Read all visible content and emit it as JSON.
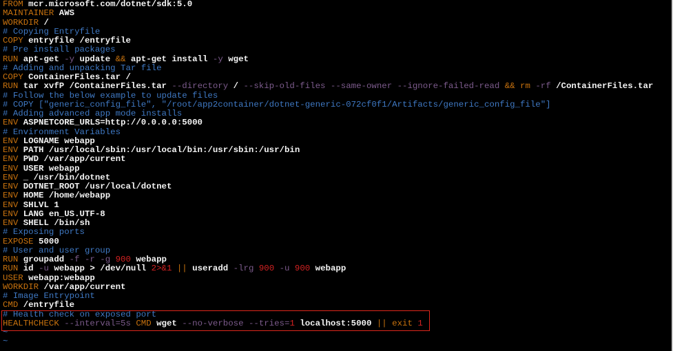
{
  "editor": {
    "lines": [
      [
        [
          "k",
          "FROM"
        ],
        [
          "t",
          " mcr.microsoft.com/dotnet/sdk:5.0"
        ]
      ],
      [
        [
          "k",
          "MAINTAINER"
        ],
        [
          "t",
          " AWS"
        ]
      ],
      [
        [
          "k",
          "WORKDIR"
        ],
        [
          "t",
          " /"
        ]
      ],
      [
        [
          "c",
          "# Copying Entryfile"
        ]
      ],
      [
        [
          "k",
          "COPY"
        ],
        [
          "t",
          " entryfile /entryfile"
        ]
      ],
      [
        [
          "c",
          "# Pre install packages"
        ]
      ],
      [
        [
          "k",
          "RUN"
        ],
        [
          "t",
          " apt-get "
        ],
        [
          "f",
          "-y"
        ],
        [
          "t",
          " update "
        ],
        [
          "o",
          "&&"
        ],
        [
          "t",
          " apt-get install "
        ],
        [
          "f",
          "-y"
        ],
        [
          "t",
          " wget"
        ]
      ],
      [
        [
          "c",
          "# Adding and unpacking Tar file"
        ]
      ],
      [
        [
          "k",
          "COPY"
        ],
        [
          "t",
          " ContainerFiles.tar /"
        ]
      ],
      [
        [
          "k",
          "RUN"
        ],
        [
          "t",
          " tar xvfP /ContainerFiles.tar "
        ],
        [
          "f",
          "--directory"
        ],
        [
          "t",
          " / "
        ],
        [
          "f",
          "--skip-old-files --same-owner --ignore-failed-read"
        ],
        [
          "t",
          " "
        ],
        [
          "o",
          "&&"
        ],
        [
          "t",
          " "
        ],
        [
          "o",
          "rm"
        ],
        [
          "t",
          " "
        ],
        [
          "f",
          "-rf"
        ],
        [
          "t",
          " /ContainerFiles.tar"
        ]
      ],
      [
        [
          "c",
          "# Follow the below example to update files"
        ]
      ],
      [
        [
          "c",
          "# COPY [\"generic_config_file\", \"/root/app2container/dotnet-generic-072cf0f1/Artifacts/generic_config_file\"]"
        ]
      ],
      [
        [
          "c",
          "# Adding advanced app mode installs"
        ]
      ],
      [
        [
          "k",
          "ENV"
        ],
        [
          "t",
          " ASPNETCORE_URLS=http://0.0.0.0:5000"
        ]
      ],
      [
        [
          "c",
          "# Environment Variables"
        ]
      ],
      [
        [
          "k",
          "ENV"
        ],
        [
          "t",
          " LOGNAME webapp"
        ]
      ],
      [
        [
          "k",
          "ENV"
        ],
        [
          "t",
          " PATH /usr/local/sbin:/usr/local/bin:/usr/sbin:/usr/bin"
        ]
      ],
      [
        [
          "k",
          "ENV"
        ],
        [
          "t",
          " PWD /var/app/current"
        ]
      ],
      [
        [
          "k",
          "ENV"
        ],
        [
          "t",
          " USER webapp"
        ]
      ],
      [
        [
          "k",
          "ENV"
        ],
        [
          "t",
          " _ /usr/bin/dotnet"
        ]
      ],
      [
        [
          "k",
          "ENV"
        ],
        [
          "t",
          " DOTNET_ROOT /usr/local/dotnet"
        ]
      ],
      [
        [
          "k",
          "ENV"
        ],
        [
          "t",
          " HOME /home/webapp"
        ]
      ],
      [
        [
          "k",
          "ENV"
        ],
        [
          "t",
          " SHLVL 1"
        ]
      ],
      [
        [
          "k",
          "ENV"
        ],
        [
          "t",
          " LANG en_US.UTF-8"
        ]
      ],
      [
        [
          "k",
          "ENV"
        ],
        [
          "t",
          " SHELL /bin/sh"
        ]
      ],
      [
        [
          "c",
          "# Exposing ports"
        ]
      ],
      [
        [
          "k",
          "EXPOSE"
        ],
        [
          "t",
          " 5000"
        ]
      ],
      [
        [
          "c",
          "# User and user group"
        ]
      ],
      [
        [
          "k",
          "RUN"
        ],
        [
          "t",
          " groupadd "
        ],
        [
          "f",
          "-f -r -g"
        ],
        [
          "t",
          " "
        ],
        [
          "n",
          "900"
        ],
        [
          "t",
          " webapp"
        ]
      ],
      [
        [
          "k",
          "RUN"
        ],
        [
          "t",
          " id "
        ],
        [
          "f",
          "-u"
        ],
        [
          "t",
          " webapp > /dev/null "
        ],
        [
          "n",
          "2>&1"
        ],
        [
          "t",
          " "
        ],
        [
          "o",
          "||"
        ],
        [
          "t",
          " useradd "
        ],
        [
          "f",
          "-lrg"
        ],
        [
          "t",
          " "
        ],
        [
          "n",
          "900"
        ],
        [
          "t",
          " "
        ],
        [
          "f",
          "-u"
        ],
        [
          "t",
          " "
        ],
        [
          "n",
          "900"
        ],
        [
          "t",
          " webapp"
        ]
      ],
      [
        [
          "k",
          "USER"
        ],
        [
          "t",
          " webapp:webapp"
        ]
      ],
      [
        [
          "k",
          "WORKDIR"
        ],
        [
          "t",
          " /var/app/current"
        ]
      ],
      [
        [
          "c",
          "# Image Entrypoint"
        ]
      ],
      [
        [
          "k",
          "CMD"
        ],
        [
          "t",
          " /entryfile"
        ]
      ],
      [
        [
          "c",
          "# Health check on exposed port"
        ]
      ],
      [
        [
          "k",
          "HEALTHCHECK"
        ],
        [
          "t",
          " "
        ],
        [
          "f",
          "--interval=5s"
        ],
        [
          "t",
          " "
        ],
        [
          "k",
          "CMD"
        ],
        [
          "t",
          " wget "
        ],
        [
          "f",
          "--no-verbose --tries="
        ],
        [
          "n",
          "1"
        ],
        [
          "t",
          " localhost:5000 "
        ],
        [
          "o",
          "||"
        ],
        [
          "t",
          " "
        ],
        [
          "k",
          "exit"
        ],
        [
          "t",
          " "
        ],
        [
          "n",
          "1"
        ]
      ],
      [
        [
          "tilde",
          "~"
        ]
      ],
      [
        [
          "tilde",
          "~"
        ]
      ]
    ]
  }
}
